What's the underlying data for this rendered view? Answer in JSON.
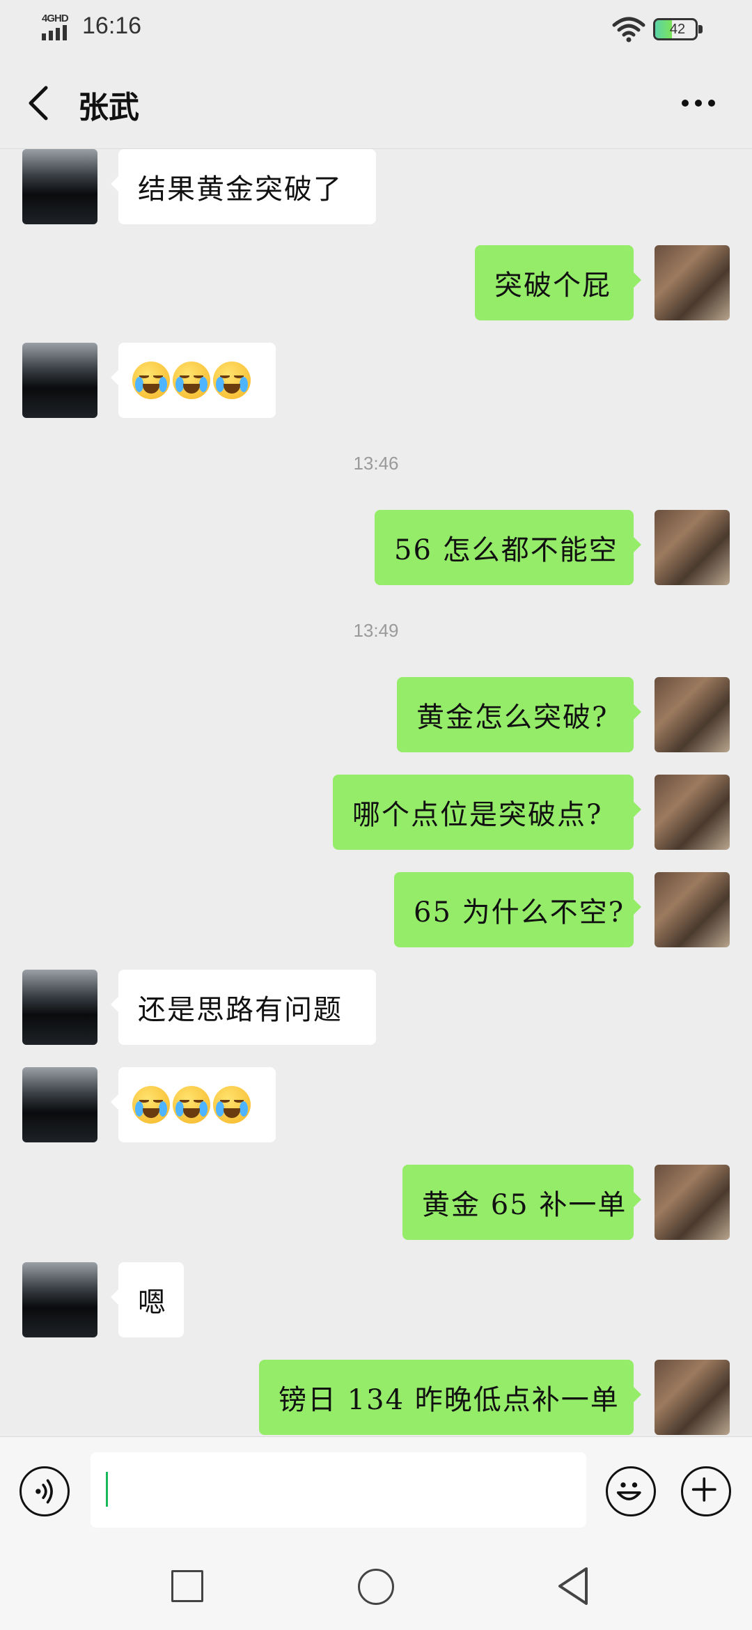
{
  "status": {
    "network": "4GHD",
    "time": "16:16",
    "battery_level": 42,
    "battery_text": "42"
  },
  "header": {
    "title": "张武",
    "back_icon": "chevron-left-icon",
    "more_icon": "more-dots-icon"
  },
  "messages": [
    {
      "type": "text",
      "side": "in",
      "text": "结果黄金突破了"
    },
    {
      "type": "text",
      "side": "out",
      "text": "突破个屁"
    },
    {
      "type": "emoji",
      "side": "in",
      "emoji": "loudly-crying-face-icon",
      "count": 3
    },
    {
      "type": "time",
      "text": "13:46"
    },
    {
      "type": "text",
      "side": "out",
      "text": "56 怎么都不能空"
    },
    {
      "type": "time",
      "text": "13:49"
    },
    {
      "type": "text",
      "side": "out",
      "text": "黄金怎么突破?"
    },
    {
      "type": "text",
      "side": "out",
      "text": "哪个点位是突破点?"
    },
    {
      "type": "text",
      "side": "out",
      "text": "65 为什么不空?"
    },
    {
      "type": "text",
      "side": "in",
      "text": "还是思路有问题"
    },
    {
      "type": "emoji",
      "side": "in",
      "emoji": "loudly-crying-face-icon",
      "count": 3
    },
    {
      "type": "text",
      "side": "out",
      "text": "黄金 65 补一单"
    },
    {
      "type": "text",
      "side": "in",
      "text": "嗯"
    },
    {
      "type": "text",
      "side": "out",
      "text": "镑日 134 昨晚低点补一单"
    }
  ],
  "input": {
    "value": "",
    "voice_icon": "voice-icon",
    "emoji_icon": "emoji-icon",
    "plus_icon": "plus-icon"
  },
  "navigation": {
    "recents_icon": "square-icon",
    "home_icon": "circle-icon",
    "back_icon": "triangle-back-icon"
  },
  "colors": {
    "outgoing_bubble": "#95ec69",
    "incoming_bubble": "#ffffff",
    "background": "#ededed",
    "cursor": "#19b85a"
  }
}
